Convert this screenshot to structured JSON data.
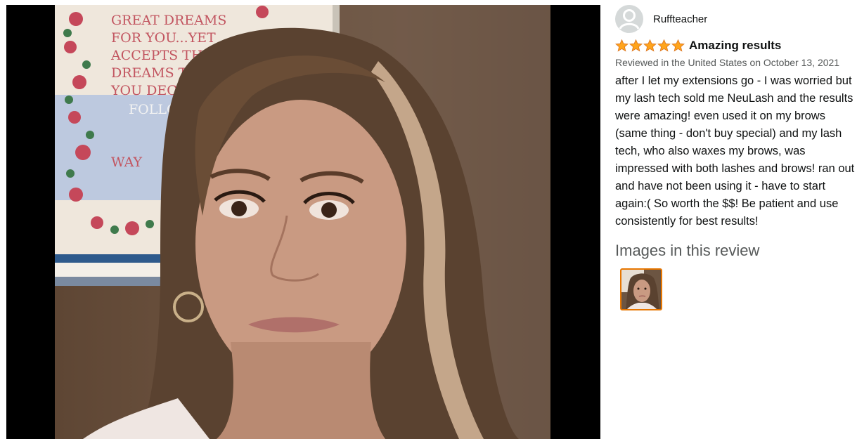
{
  "review": {
    "author": "Ruffteacher",
    "rating": 5,
    "rating_max": 5,
    "title": "Amazing results",
    "meta": "Reviewed in the United States on October 13, 2021",
    "body": "after I let my extensions go - I was worried but my lash tech sold me NeuLash and the results were amazing! even used it on my brows (same thing - don't buy special) and my lash tech, who also waxes my brows, was impressed with both lashes and brows! ran out and have not been using it - have to start again:( So worth the $$! Be patient and use consistently for best results!",
    "images_heading": "Images in this review"
  },
  "photo": {
    "sign_lines": [
      "GREAT DREAMS",
      "FOR YOU...YET",
      "ACCEPTS THE",
      "DREAMS TH",
      "YOU DECIDE",
      "FOLLOW",
      "WAY"
    ]
  },
  "colors": {
    "star": "#ffa41c",
    "thumb_border": "#e77600",
    "meta_text": "#565959"
  },
  "icons": {
    "avatar": "user-avatar-icon",
    "star": "star-icon"
  }
}
